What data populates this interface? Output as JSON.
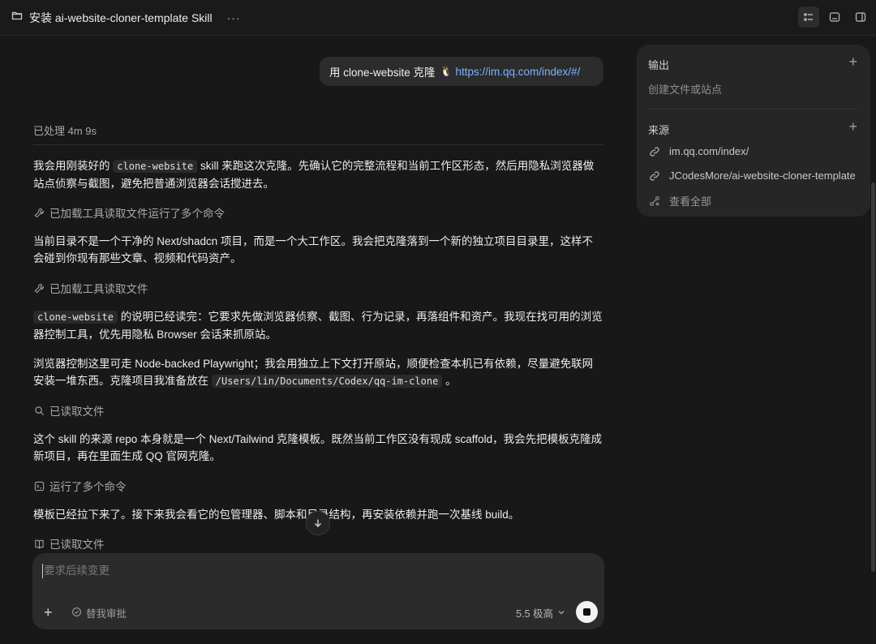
{
  "window": {
    "title": "安装 ai-website-cloner-template Skill",
    "more_label": "···"
  },
  "chat": {
    "user_message": {
      "prefix": "用 clone-website 克隆",
      "link": "https://im.qq.com/index/#/"
    },
    "processed_label": "已处理 4m 9s",
    "messages": [
      {
        "pre": "我会用刚装好的",
        "code": "clone-website",
        "post": "skill 来跑这次克隆。先确认它的完整流程和当前工作区形态，然后用隐私浏览器做站点侦察与截图，避免把普通浏览器会话搅进去。"
      },
      {
        "text": "当前目录不是一个干净的 Next/shadcn 项目，而是一个大工作区。我会把克隆落到一个新的独立项目目录里，这样不会碰到你现有那些文章、视频和代码资产。"
      },
      {
        "code": "clone-website",
        "post": "的说明已经读完：它要求先做浏览器侦察、截图、行为记录，再落组件和资产。我现在找可用的浏览器控制工具，优先用隐私 Browser 会话来抓原站。"
      },
      {
        "pre": "浏览器控制这里可走 Node-backed Playwright；我会用独立上下文打开原站，顺便检查本机已有依赖，尽量避免联网安装一堆东西。克隆项目我准备放在",
        "code": "/Users/lin/Documents/Codex/qq-im-clone",
        "post": "。"
      },
      {
        "text": "这个 skill 的来源 repo 本身就是一个 Next/Tailwind 克隆模板。既然当前工作区没有现成 scaffold，我会先把模板克隆成新项目，再在里面生成 QQ 官网克隆。"
      },
      {
        "text": "模板已经拉下来了。接下来我会看它的包管理器、脚本和目录结构，再安装依赖并跑一次基线 build。"
      }
    ],
    "tools": [
      {
        "label": "已加载工具读取文件运行了多个命令",
        "icon": "wrench-icon"
      },
      {
        "label": "已加载工具读取文件",
        "icon": "wrench-icon"
      },
      {
        "label": "已读取文件",
        "icon": "search-icon"
      },
      {
        "label": "运行了多个命令",
        "icon": "terminal-icon"
      },
      {
        "label": "已读取文件",
        "icon": "book-icon"
      }
    ]
  },
  "composer": {
    "placeholder": "要求后续变更",
    "add_label": "+",
    "review_label": "替我审批",
    "model_label": "5.5 极高"
  },
  "panel": {
    "output": {
      "title": "输出",
      "subtitle": "创建文件或站点"
    },
    "sources": {
      "title": "来源",
      "items": [
        "im.qq.com/index/",
        "JCodesMore/ai-website-cloner-template"
      ],
      "view_all": "查看全部"
    }
  }
}
